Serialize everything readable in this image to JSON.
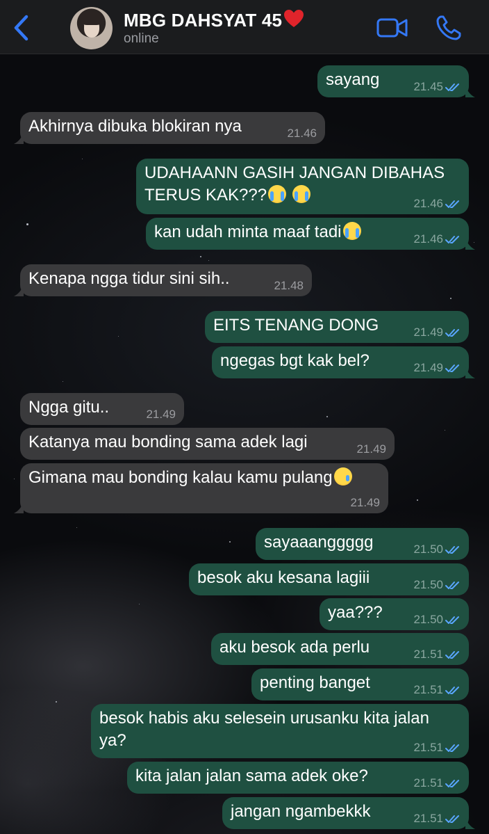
{
  "header": {
    "contact_name": "MBG DAHSYAT 45",
    "status": "online"
  },
  "colors": {
    "outgoing_bubble": "#1f5041",
    "incoming_bubble": "#3a3a3c",
    "accent": "#3478f6",
    "read_check": "#5aa6ff"
  },
  "icons": [
    "chevron-left-icon",
    "heart-icon",
    "video-camera-icon",
    "phone-icon",
    "double-check-icon",
    "crying-emoji",
    "sad-emoji"
  ],
  "messages": [
    {
      "dir": "out",
      "text": "sayang",
      "time": "21.45",
      "read": true
    },
    {
      "dir": "in",
      "text": "Akhirnya dibuka blokiran nya",
      "time": "21.46"
    },
    {
      "dir": "out",
      "text": "UDAHAANN GASIH JANGAN DIBAHAS",
      "text2": "TERUS KAK???",
      "time": "21.46",
      "read": true
    },
    {
      "dir": "out",
      "text": "kan udah minta maaf tadi",
      "time": "21.46",
      "read": true
    },
    {
      "dir": "in",
      "text": "Kenapa ngga tidur sini sih..",
      "time": "21.48"
    },
    {
      "dir": "out",
      "text": "EITS TENANG DONG",
      "time": "21.49",
      "read": true
    },
    {
      "dir": "out",
      "text": "ngegas bgt kak bel?",
      "time": "21.49",
      "read": true
    },
    {
      "dir": "in",
      "text": "Ngga gitu..",
      "time": "21.49"
    },
    {
      "dir": "in",
      "text": "Katanya mau bonding sama adek lagi",
      "time": "21.49"
    },
    {
      "dir": "in",
      "text": "Gimana mau bonding kalau kamu pulang",
      "time": "21.49"
    },
    {
      "dir": "out",
      "text": "sayaaanggggg",
      "time": "21.50",
      "read": true
    },
    {
      "dir": "out",
      "text": "besok aku kesana lagiii",
      "time": "21.50",
      "read": true
    },
    {
      "dir": "out",
      "text": "yaa???",
      "time": "21.50",
      "read": true
    },
    {
      "dir": "out",
      "text": "aku besok ada perlu",
      "time": "21.51",
      "read": true
    },
    {
      "dir": "out",
      "text": "penting banget",
      "time": "21.51",
      "read": true
    },
    {
      "dir": "out",
      "text": "besok habis aku selesein urusanku kita jalan",
      "text2": "ya?",
      "time": "21.51",
      "read": true
    },
    {
      "dir": "out",
      "text": "kita jalan jalan sama adek oke?",
      "time": "21.51",
      "read": true
    },
    {
      "dir": "out",
      "text": "jangan ngambekkk",
      "time": "21.51",
      "read": true
    }
  ]
}
